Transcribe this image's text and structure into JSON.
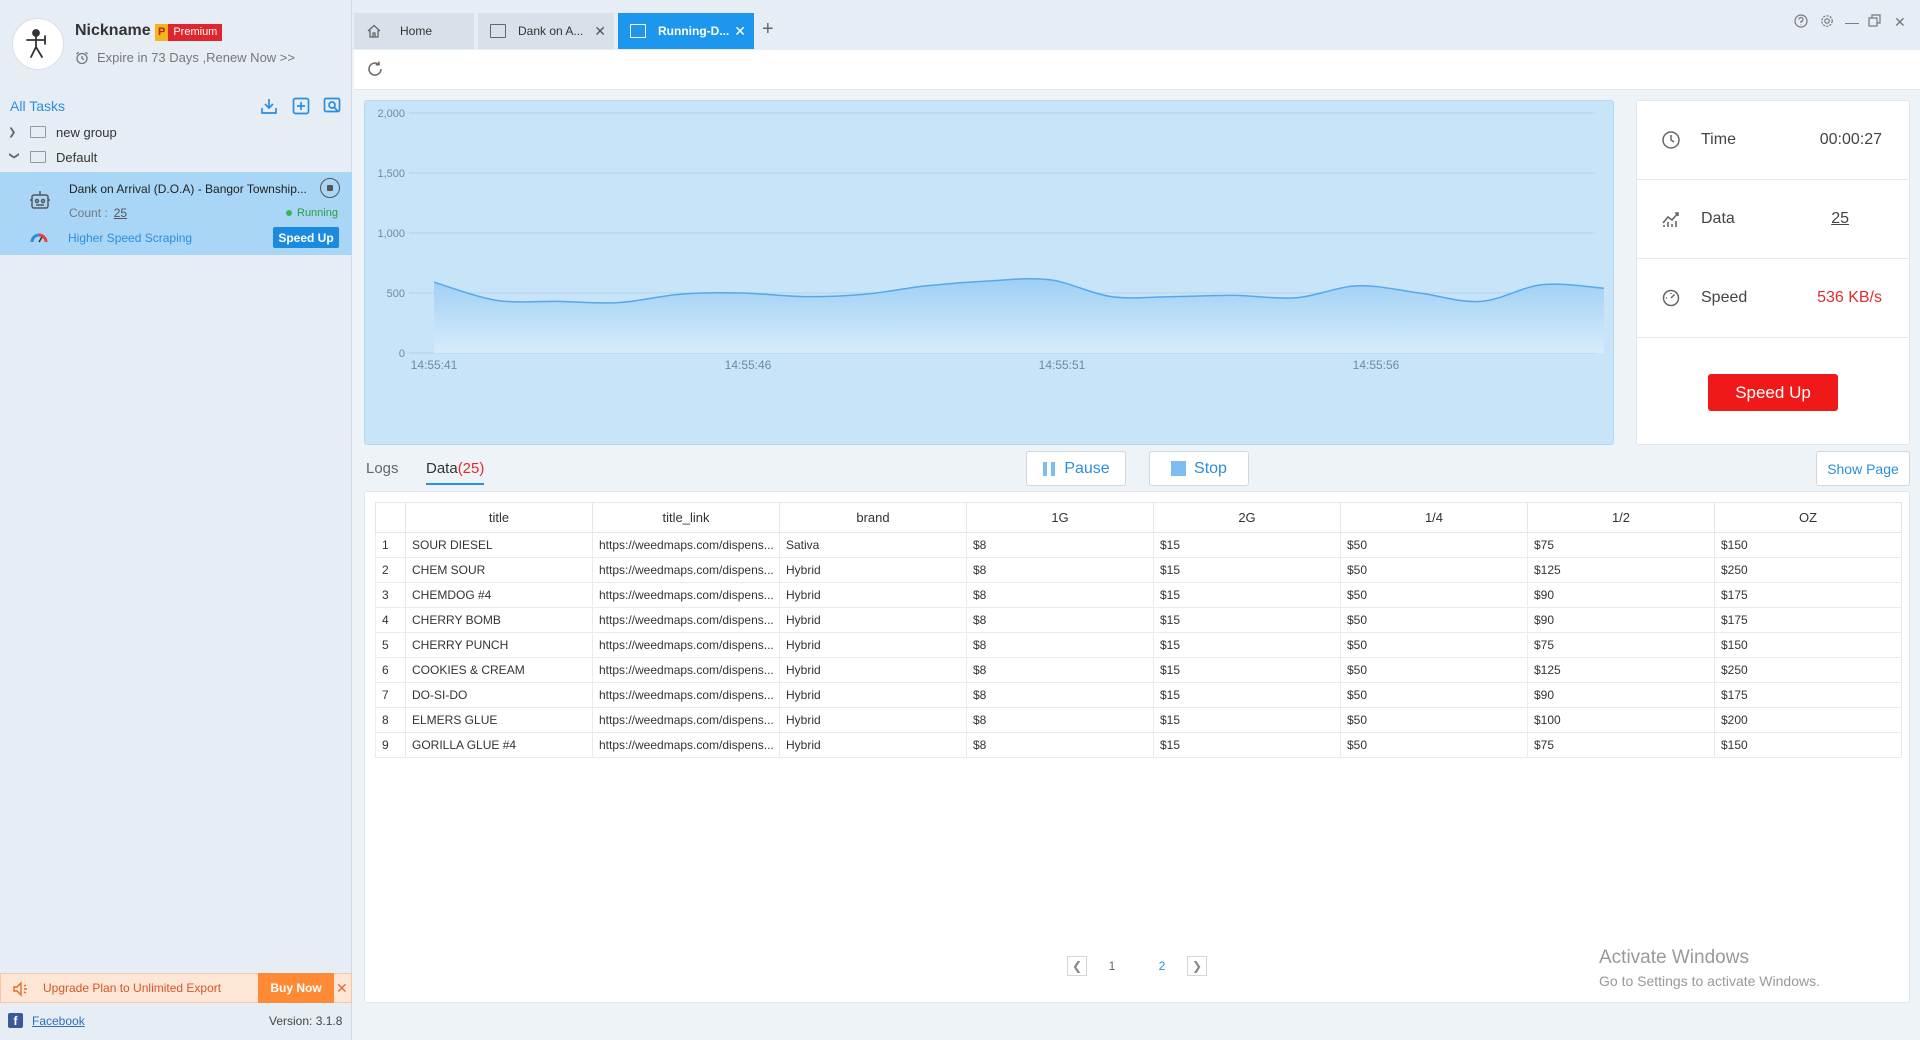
{
  "user": {
    "nickname": "Nickname",
    "badge_letter": "P",
    "badge_text": "Premium",
    "expire_text": "Expire in 73 Days ,Renew Now >>"
  },
  "sidebar": {
    "all_tasks": "All Tasks",
    "groups": [
      {
        "label": "new group",
        "expanded": false
      },
      {
        "label": "Default",
        "expanded": true
      }
    ],
    "task": {
      "title": "Dank on Arrival (D.O.A) - Bangor Township...",
      "count_label": "Count :",
      "count_value": "25",
      "status": "Running",
      "higher_speed": "Higher Speed Scraping",
      "speed_up": "Speed Up"
    },
    "upgrade": {
      "text": "Upgrade Plan to Unlimited Export",
      "buy_now": "Buy Now"
    },
    "facebook": "Facebook",
    "version": "Version: 3.1.8"
  },
  "tabs": [
    {
      "label": "Home",
      "active": false
    },
    {
      "label": "Dank on A...",
      "active": false
    },
    {
      "label": "Running-D...",
      "active": true
    }
  ],
  "stats": {
    "time_label": "Time",
    "time_value": "00:00:27",
    "data_label": "Data",
    "data_value": "25",
    "speed_label": "Speed",
    "speed_value": "536 KB/s",
    "speed_up": "Speed Up"
  },
  "chart_data": {
    "type": "area",
    "title": "",
    "xlabel": "",
    "ylabel": "",
    "ylim": [
      0,
      2000
    ],
    "y_ticks": [
      0,
      500,
      1000,
      1500,
      2000
    ],
    "x_tick_labels": [
      "14:55:41",
      "14:55:46",
      "14:55:51",
      "14:55:56"
    ],
    "x_tick_index": [
      0,
      5,
      10,
      15
    ],
    "values": [
      590,
      440,
      430,
      420,
      490,
      500,
      470,
      490,
      560,
      600,
      610,
      470,
      470,
      480,
      460,
      560,
      500,
      430,
      570,
      540
    ],
    "grid": true,
    "colors": {
      "fill": "#9fcff4",
      "line": "#55a8ec",
      "background": "#c8e4f8"
    }
  },
  "data_panel": {
    "logs_tab": "Logs",
    "data_tab": "Data",
    "data_count": "(25)",
    "pause": "Pause",
    "stop": "Stop",
    "show_page": "Show Page",
    "columns": [
      "",
      "title",
      "title_link",
      "brand",
      "1G",
      "2G",
      "1/4",
      "1/2",
      "OZ"
    ],
    "rows": [
      [
        "1",
        "SOUR DIESEL",
        "https://weedmaps.com/dispens...",
        "Sativa",
        "$8",
        "$15",
        "$50",
        "$75",
        "$150"
      ],
      [
        "2",
        "CHEM SOUR",
        "https://weedmaps.com/dispens...",
        "Hybrid",
        "$8",
        "$15",
        "$50",
        "$125",
        "$250"
      ],
      [
        "3",
        "CHEMDOG #4",
        "https://weedmaps.com/dispens...",
        "Hybrid",
        "$8",
        "$15",
        "$50",
        "$90",
        "$175"
      ],
      [
        "4",
        "CHERRY BOMB",
        "https://weedmaps.com/dispens...",
        "Hybrid",
        "$8",
        "$15",
        "$50",
        "$90",
        "$175"
      ],
      [
        "5",
        "CHERRY PUNCH",
        "https://weedmaps.com/dispens...",
        "Hybrid",
        "$8",
        "$15",
        "$50",
        "$75",
        "$150"
      ],
      [
        "6",
        "COOKIES & CREAM",
        "https://weedmaps.com/dispens...",
        "Hybrid",
        "$8",
        "$15",
        "$50",
        "$125",
        "$250"
      ],
      [
        "7",
        "DO-SI-DO",
        "https://weedmaps.com/dispens...",
        "Hybrid",
        "$8",
        "$15",
        "$50",
        "$90",
        "$175"
      ],
      [
        "8",
        "ELMERS GLUE",
        "https://weedmaps.com/dispens...",
        "Hybrid",
        "$8",
        "$15",
        "$50",
        "$100",
        "$200"
      ],
      [
        "9",
        "GORILLA GLUE #4",
        "https://weedmaps.com/dispens...",
        "Hybrid",
        "$8",
        "$15",
        "$50",
        "$75",
        "$150"
      ]
    ],
    "pages": [
      "1",
      "2"
    ],
    "active_page": "2"
  },
  "watermark": {
    "title": "Activate Windows",
    "subtitle": "Go to Settings to activate Windows."
  }
}
